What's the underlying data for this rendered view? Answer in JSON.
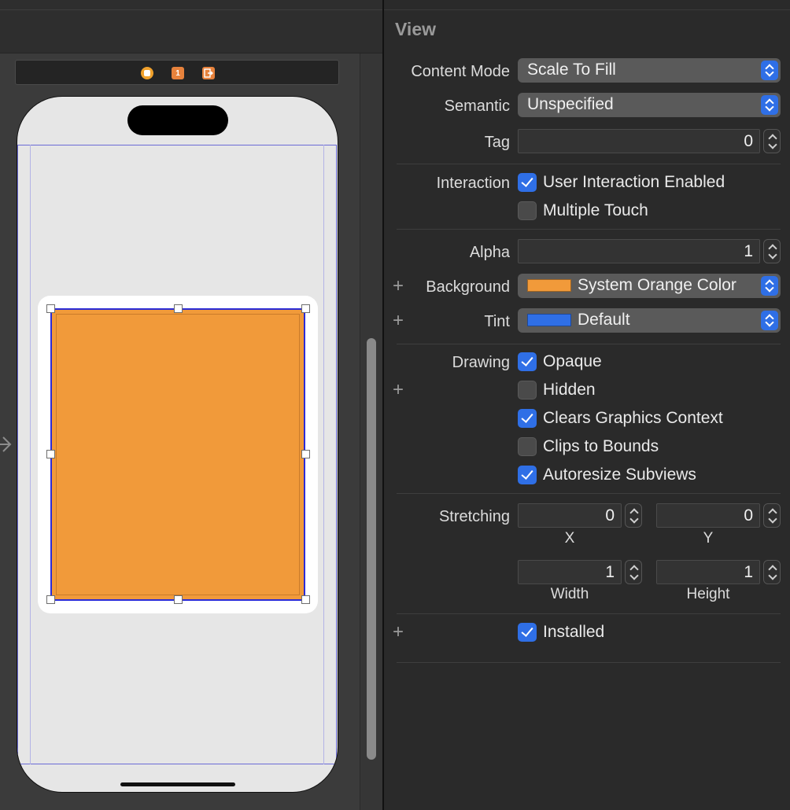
{
  "inspector": {
    "section_title": "View",
    "content_mode": {
      "label": "Content Mode",
      "value": "Scale To Fill"
    },
    "semantic": {
      "label": "Semantic",
      "value": "Unspecified"
    },
    "tag": {
      "label": "Tag",
      "value": "0"
    },
    "interaction": {
      "label": "Interaction",
      "user_interaction_enabled": {
        "label": "User Interaction Enabled",
        "checked": true
      },
      "multiple_touch": {
        "label": "Multiple Touch",
        "checked": false
      }
    },
    "alpha": {
      "label": "Alpha",
      "value": "1"
    },
    "background": {
      "label": "Background",
      "value": "System Orange Color",
      "swatch": "#f19a3a"
    },
    "tint": {
      "label": "Tint",
      "value": "Default",
      "swatch": "#2f6fe6"
    },
    "drawing": {
      "label": "Drawing",
      "opaque": {
        "label": "Opaque",
        "checked": true
      },
      "hidden": {
        "label": "Hidden",
        "checked": false
      },
      "clears_graphics_context": {
        "label": "Clears Graphics Context",
        "checked": true
      },
      "clips_to_bounds": {
        "label": "Clips to Bounds",
        "checked": false
      },
      "autoresize_subviews": {
        "label": "Autoresize Subviews",
        "checked": true
      }
    },
    "stretching": {
      "label": "Stretching",
      "x": {
        "label": "X",
        "value": "0"
      },
      "y": {
        "label": "Y",
        "value": "0"
      },
      "width": {
        "label": "Width",
        "value": "1"
      },
      "height": {
        "label": "Height",
        "value": "1"
      }
    },
    "installed": {
      "label": "Installed",
      "checked": true
    }
  },
  "canvas": {
    "dock_icons": [
      "view-controller-icon",
      "first-responder-icon",
      "exit-icon"
    ],
    "dock_first_responder_glyph": "1",
    "selected_view_color": "#f19a3a",
    "selection_color": "#2b2bd6"
  }
}
